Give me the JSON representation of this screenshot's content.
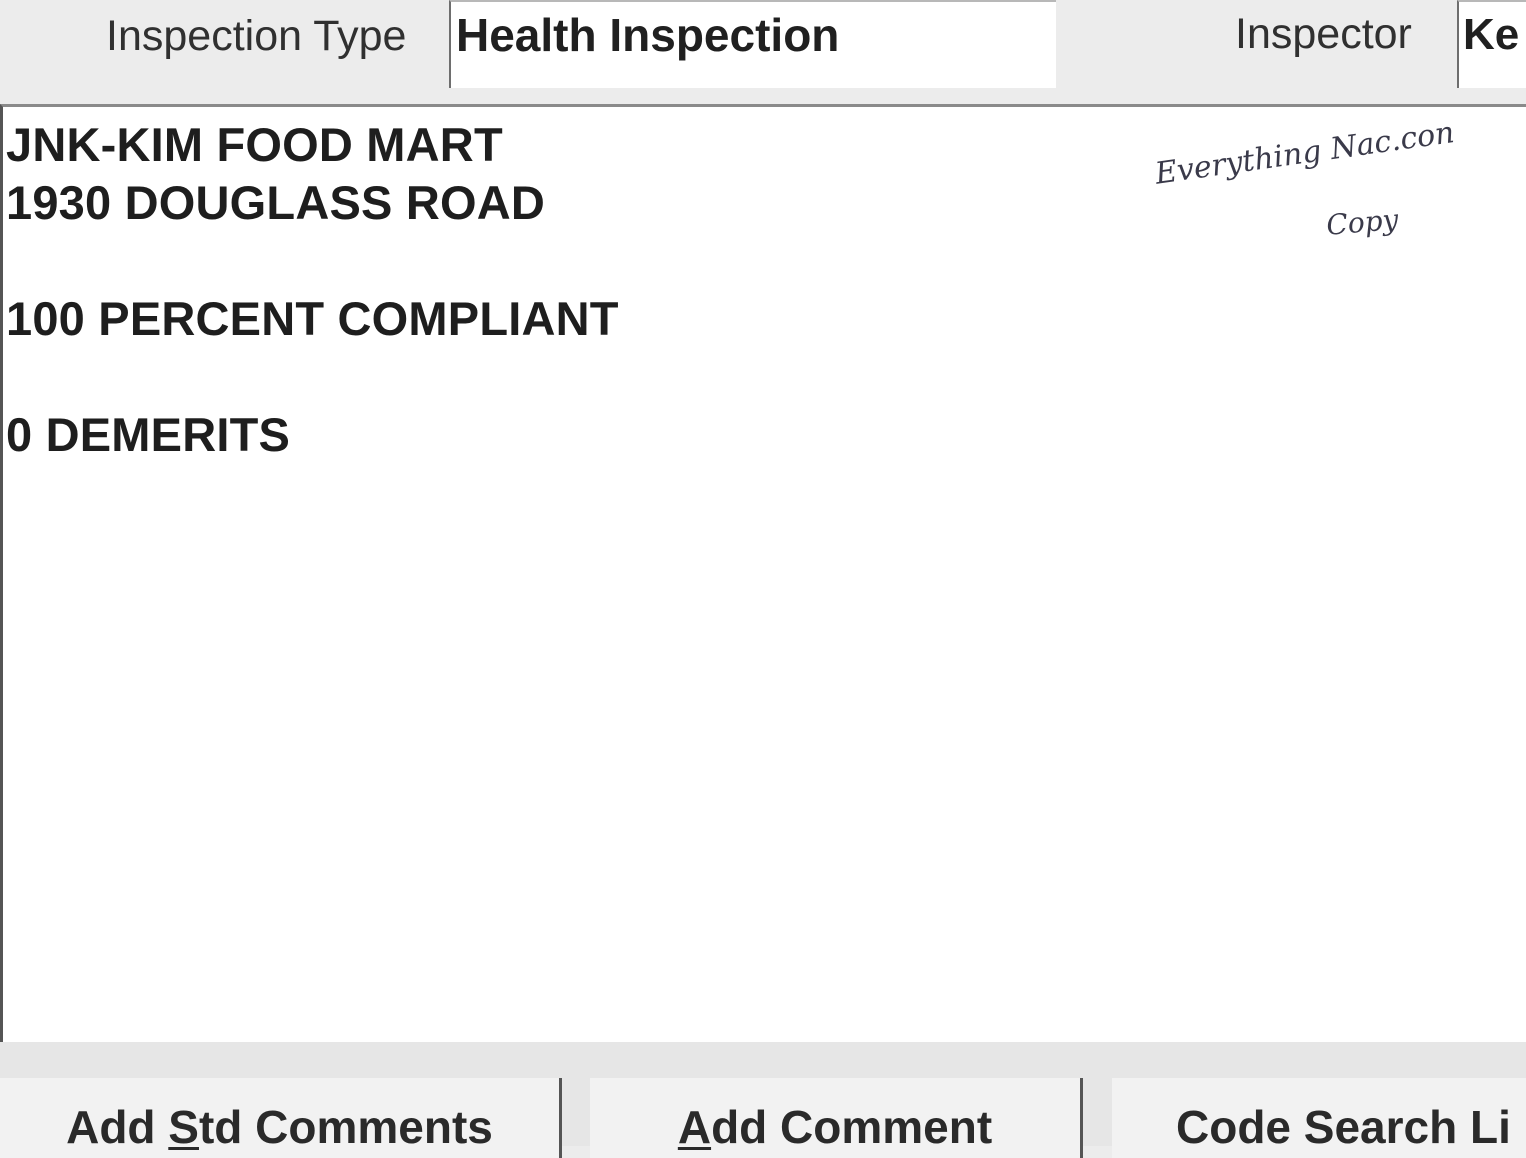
{
  "header": {
    "inspection_type_label": "Inspection Type",
    "inspection_type_value": "Health Inspection",
    "inspector_label": "Inspector",
    "inspector_value": "Ke"
  },
  "comments": {
    "lines": [
      "JNK-KIM FOOD MART",
      "1930 DOUGLASS ROAD",
      "100 PERCENT COMPLIANT",
      "0 DEMERITS"
    ],
    "handwritten_note": [
      "Everything Nac.con",
      "Copy"
    ]
  },
  "buttons": {
    "add_std_comments": {
      "pre": "Add ",
      "mnemonic": "S",
      "post": "td Comments"
    },
    "add_comment": {
      "pre": "",
      "mnemonic": "A",
      "post": "dd Comment"
    },
    "code_search": "Code Search Li"
  }
}
